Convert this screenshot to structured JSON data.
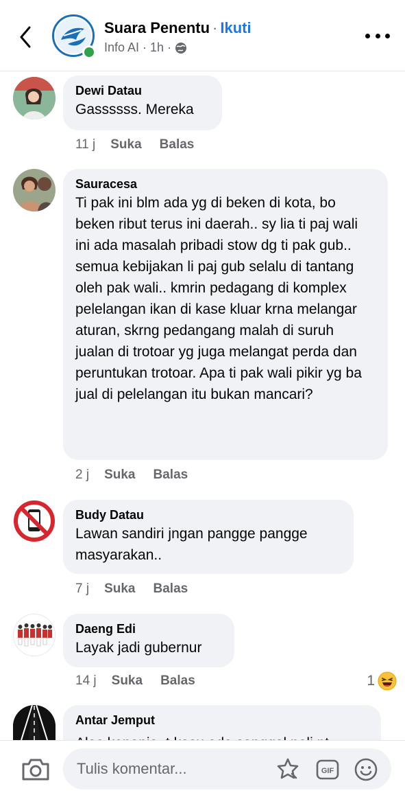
{
  "header": {
    "page_name": "Suara Penentu",
    "separator": "·",
    "follow_label": "Ikuti",
    "subtitle_label": "Info AI",
    "subtitle_sep1": "·",
    "time": "1h",
    "subtitle_sep2": "·",
    "icons": {
      "back": "chevron-left-icon",
      "more": "more-dots-icon",
      "audience": "globe-icon"
    }
  },
  "comments": [
    {
      "name": "Dewi Datau",
      "text": "Gassssss. Mereka",
      "time": "11 j",
      "like": "Suka",
      "reply": "Balas"
    },
    {
      "name": "Sauracesa",
      "text": "Ti pak ini blm ada yg di beken di kota, bo beken ribut terus ini daerah.. sy lia ti paj wali ini ada masalah pribadi stow dg ti pak gub.. semua kebijakan li paj gub selalu di tantang oleh pak wali.. kmrin pedagang di komplex pelelangan ikan di kase kluar krna melangar aturan, skrng pedangang malah di suruh jualan di trotoar yg juga melangat perda dan peruntukan trotoar. Apa ti pak wali pikir yg ba jual di pelelangan itu bukan mancari?",
      "time": "2 j",
      "like": "Suka",
      "reply": "Balas"
    },
    {
      "name": "Budy Datau",
      "text": "Lawan sandiri jngan pangge pangge masyarakan..",
      "time": "7 j",
      "like": "Suka",
      "reply": "Balas"
    },
    {
      "name": "Daeng Edi",
      "text": "Layak jadi gubernur",
      "time": "14 j",
      "like": "Suka",
      "reply": "Balas",
      "reaction_count": "1",
      "reaction_icon": "laughing-emoji-icon"
    },
    {
      "name": "Antar Jemput",
      "text": "Alas kenapia, t kasu ada sanggal nali nt",
      "time": "",
      "like": "",
      "reply": ""
    }
  ],
  "composer": {
    "placeholder": "Tulis komentar...",
    "icons": {
      "camera": "camera-icon",
      "sticker": "sticker-icon",
      "gif": "GIF",
      "emoji": "emoji-icon"
    }
  },
  "colors": {
    "accent": "#1877f2",
    "bubble": "#f0f2f5",
    "meta": "#65676b",
    "online": "#31a24c"
  }
}
